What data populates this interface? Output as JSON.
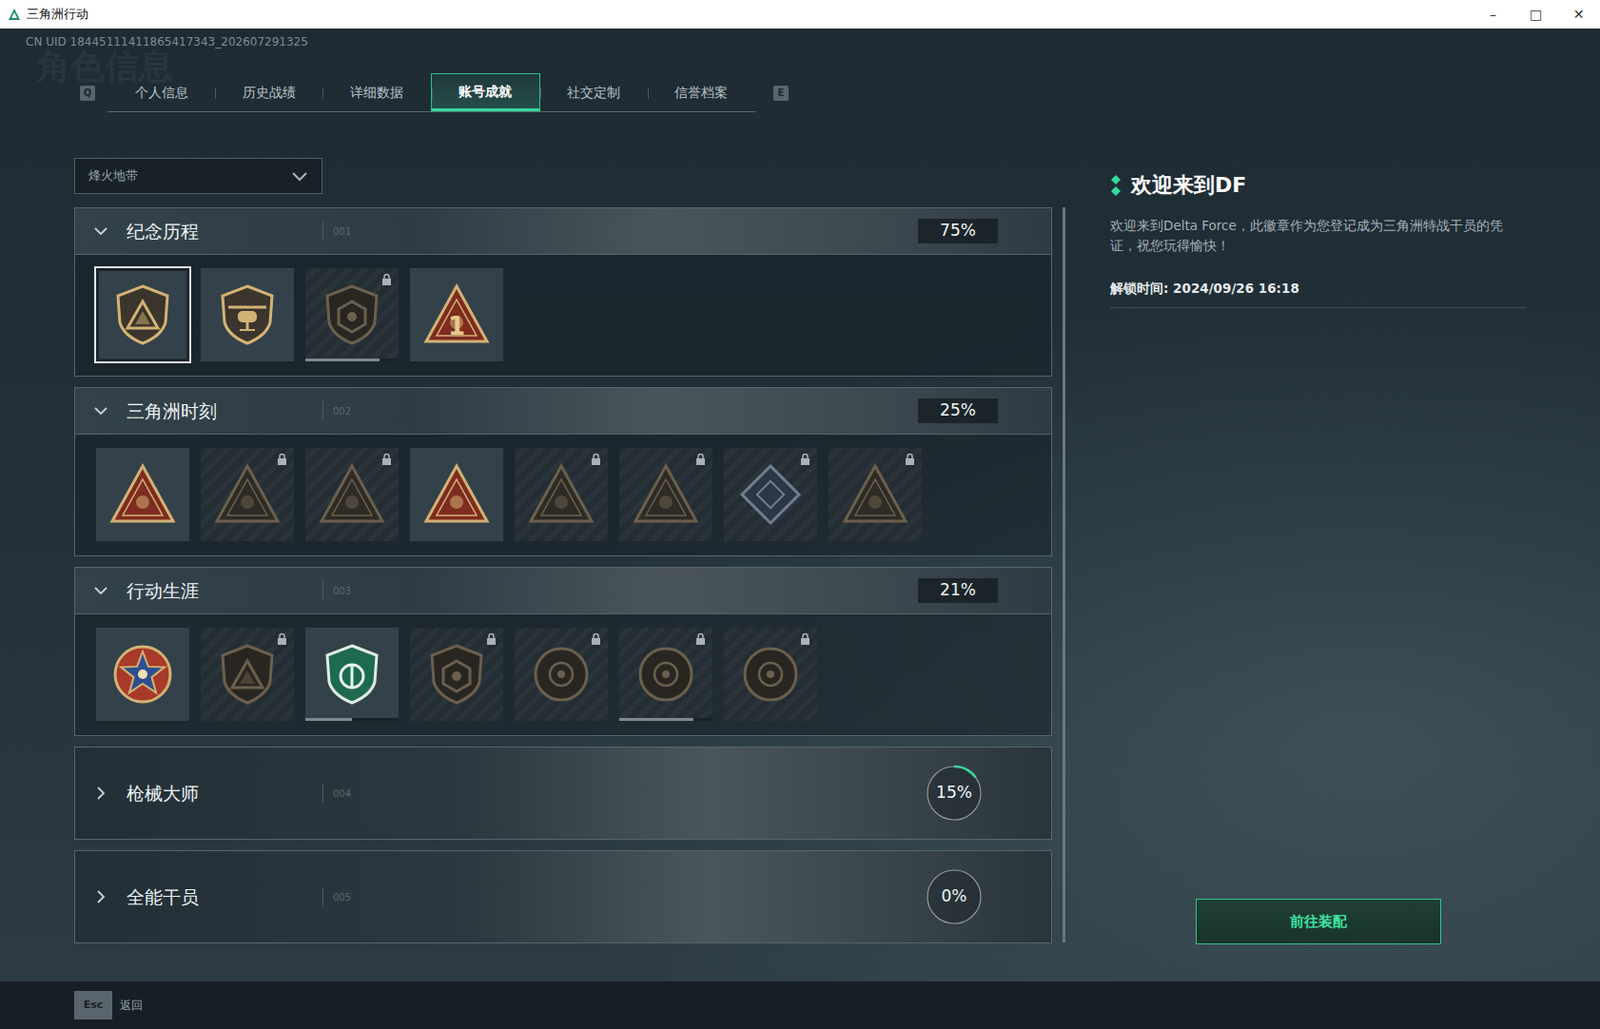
{
  "window": {
    "title": "三角洲行动",
    "controls": [
      "–",
      "□",
      "✕"
    ]
  },
  "uid": "CN UID 18445111411865417343_202607291325",
  "watermark": "角色信息",
  "tabs": {
    "prev_key": "Q",
    "next_key": "E",
    "items": [
      {
        "label": "个人信息",
        "selected": false
      },
      {
        "label": "历史战绩",
        "selected": false
      },
      {
        "label": "详细数据",
        "selected": false
      },
      {
        "label": "账号成就",
        "selected": true
      },
      {
        "label": "社交定制",
        "selected": false
      },
      {
        "label": "信誉档案",
        "selected": false
      }
    ]
  },
  "mode_select": {
    "value": "烽火地带"
  },
  "sections": [
    {
      "title": "纪念历程",
      "index": "001",
      "percent": "75%",
      "expanded": true,
      "badges": [
        {
          "kind": "shield",
          "locked": false,
          "selected": true,
          "level": 0
        },
        {
          "kind": "heli",
          "locked": false,
          "selected": false,
          "level": 0
        },
        {
          "kind": "hex",
          "locked": true,
          "selected": false,
          "level": 0.8
        },
        {
          "kind": "triangle",
          "locked": false,
          "selected": false,
          "level": 0,
          "glyph": "1"
        }
      ]
    },
    {
      "title": "三角洲时刻",
      "index": "002",
      "percent": "25%",
      "expanded": true,
      "badges": [
        {
          "kind": "triangle",
          "locked": false,
          "selected": false,
          "level": 0
        },
        {
          "kind": "triangle",
          "locked": true,
          "selected": false,
          "level": 0
        },
        {
          "kind": "triangle",
          "locked": true,
          "selected": false,
          "level": 0
        },
        {
          "kind": "triangle",
          "locked": false,
          "selected": false,
          "level": 0
        },
        {
          "kind": "triangle",
          "locked": true,
          "selected": false,
          "level": 0
        },
        {
          "kind": "triangle",
          "locked": true,
          "selected": false,
          "level": 0
        },
        {
          "kind": "diamond",
          "locked": true,
          "selected": false,
          "level": 0
        },
        {
          "kind": "triangle",
          "locked": true,
          "selected": false,
          "level": 0
        }
      ]
    },
    {
      "title": "行动生涯",
      "index": "003",
      "percent": "21%",
      "expanded": true,
      "badges": [
        {
          "kind": "medal",
          "locked": false,
          "selected": false,
          "level": 0
        },
        {
          "kind": "shield",
          "locked": true,
          "selected": false,
          "level": 0
        },
        {
          "kind": "green",
          "locked": false,
          "selected": false,
          "level": 0.5
        },
        {
          "kind": "hex",
          "locked": true,
          "selected": false,
          "level": 0
        },
        {
          "kind": "circle",
          "locked": true,
          "selected": false,
          "level": 0
        },
        {
          "kind": "circle",
          "locked": true,
          "selected": false,
          "level": 0.8
        },
        {
          "kind": "circle",
          "locked": true,
          "selected": false,
          "level": 0
        }
      ]
    },
    {
      "title": "枪械大师",
      "index": "004",
      "percent": "15%",
      "expanded": false,
      "level": 0.15,
      "badges": []
    },
    {
      "title": "全能干员",
      "index": "005",
      "percent": "0%",
      "expanded": false,
      "level": 0,
      "badges": []
    }
  ],
  "detail": {
    "title": "欢迎来到DF",
    "description": "欢迎来到Delta Force，此徽章作为您登记成为三角洲特战干员的凭证，祝您玩得愉快！",
    "unlock": "解锁时间: 2024/09/26 16:18",
    "button": "前往装配"
  },
  "footer": {
    "key": "Esc",
    "label": "返回"
  }
}
